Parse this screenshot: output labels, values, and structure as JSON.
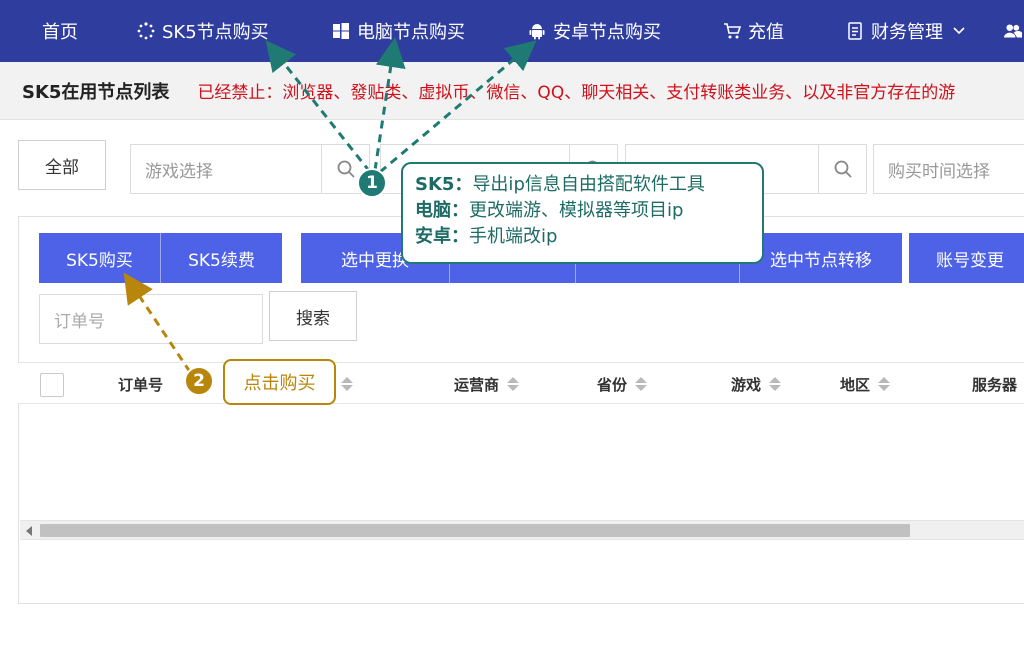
{
  "nav": {
    "items": [
      {
        "label": "首页"
      },
      {
        "label": "SK5节点购买",
        "icon": "loading-circle-icon"
      },
      {
        "label": "电脑节点购买",
        "icon": "windows-icon"
      },
      {
        "label": "安卓节点购买",
        "icon": "android-icon"
      },
      {
        "label": "充值",
        "icon": "cart-icon"
      },
      {
        "label": "财务管理",
        "icon": "document-icon"
      }
    ],
    "bg_color": "#2f3e9e"
  },
  "notice": {
    "title": "SK5在用节点列表",
    "text": "已经禁止：浏览器、發贴类、虚拟币、微信、QQ、聊天相关、支付转账类业务、以及非官方存在的游"
  },
  "filters": {
    "all_label": "全部",
    "game_placeholder": "游戏选择",
    "time_placeholder": "购买时间选择"
  },
  "actions": {
    "sk5_buy": "SK5购买",
    "sk5_renew": "SK5续费",
    "change_partial": "选中更换",
    "transfer": "选中节点转移",
    "account_change": "账号变更",
    "accent_color": "#4d62e6"
  },
  "search": {
    "order_placeholder": "订单号",
    "button": "搜索"
  },
  "table": {
    "columns": [
      "订单号",
      "运营商",
      "省份",
      "游戏",
      "地区",
      "服务器"
    ]
  },
  "annotation1": {
    "number": "1",
    "lines": [
      {
        "key": "SK5：",
        "value": "导出ip信息自由搭配软件工具"
      },
      {
        "key": "电脑：",
        "value": "更改端游、模拟器等项目ip"
      },
      {
        "key": "安卓：",
        "value": "手机端改ip"
      }
    ],
    "color": "#1e7a72"
  },
  "annotation2": {
    "number": "2",
    "text": "点击购买",
    "color": "#b8860b"
  }
}
